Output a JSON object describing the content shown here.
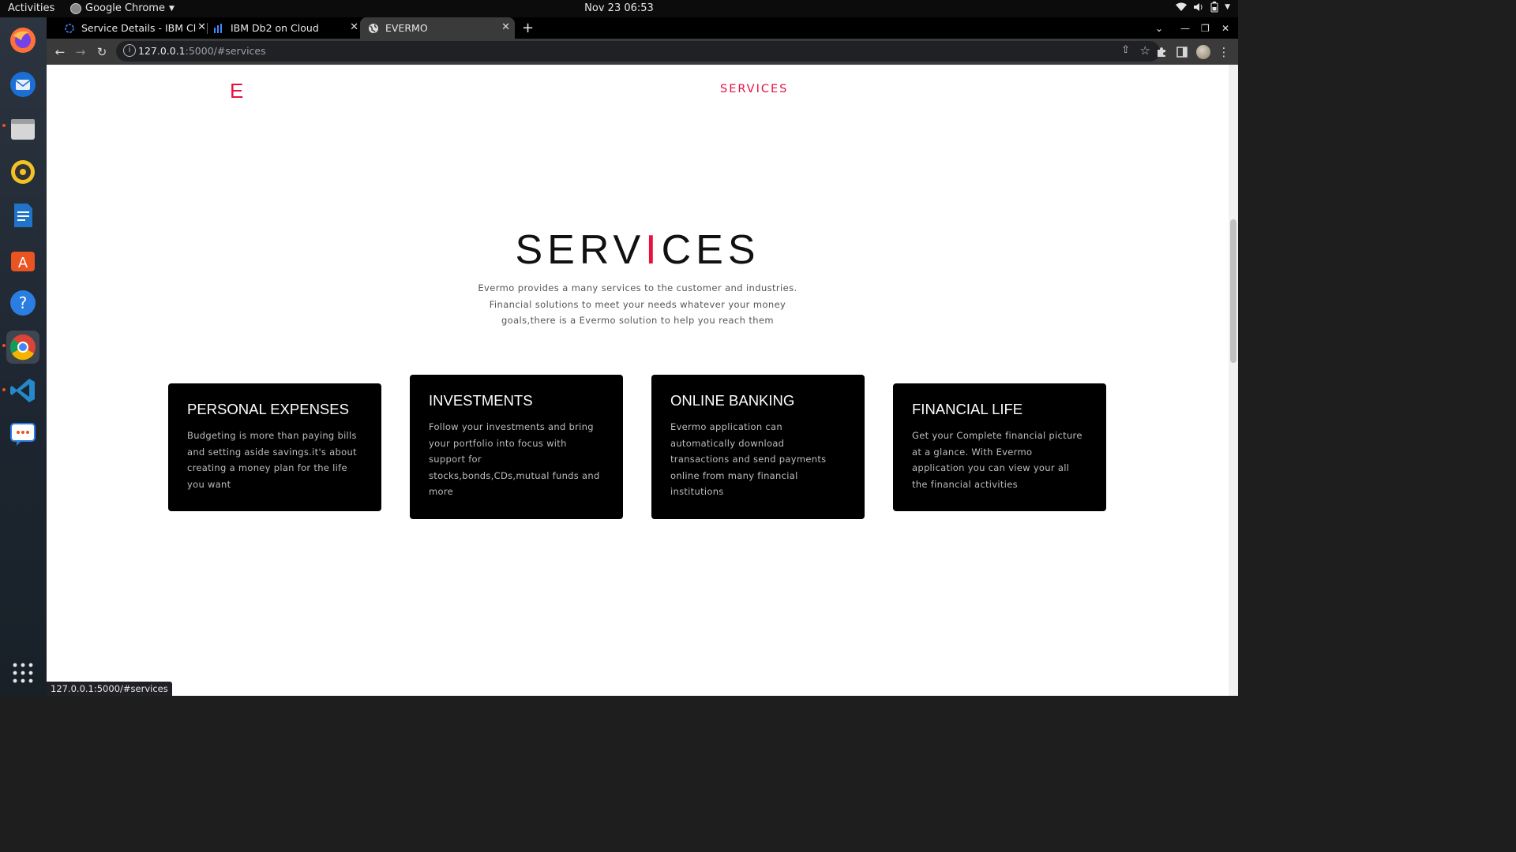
{
  "system": {
    "activities": "Activities",
    "app_name": "Google Chrome",
    "clock": "Nov 23  06:53"
  },
  "dock": [
    "firefox-icon",
    "thunderbird-icon",
    "files-icon",
    "rhythmbox-icon",
    "writer-icon",
    "software-center-icon",
    "help-icon",
    "chrome-icon",
    "vscode-icon",
    "chat-icon",
    "app-grid-icon"
  ],
  "tabs": [
    {
      "title": "Service Details - IBM Cloud",
      "active": false
    },
    {
      "title": "IBM Db2 on Cloud",
      "active": false
    },
    {
      "title": "EVERMO",
      "active": true
    }
  ],
  "address": {
    "host": "127.0.0.1",
    "path": ":5000/#services"
  },
  "site": {
    "logo": "E",
    "nav": "SERVICES",
    "title_left": "SERV",
    "title_bar": "I",
    "title_right": "CES",
    "intro": "Evermo provides a many services to the customer and industries. Financial solutions to meet your needs whatever your money goals,there is a Evermo solution to help you reach them"
  },
  "cards": [
    {
      "title": "PERSONAL EXPENSES",
      "text": "Budgeting is more than paying bills and setting aside savings.it's about creating a money plan for the life you want"
    },
    {
      "title": "INVESTMENTS",
      "text": "Follow your investments and bring your portfolio into focus with support for stocks,bonds,CDs,mutual funds and more"
    },
    {
      "title": "ONLINE BANKING",
      "text": "Evermo application can automatically download transactions and send payments online from many financial institutions"
    },
    {
      "title": "FINANCIAL LIFE",
      "text": "Get your Complete financial picture at a glance. With Evermo application you can view your all the financial activities"
    }
  ],
  "status_url": "127.0.0.1:5000/#services",
  "colors": {
    "accent": "#e8113d",
    "card_bg": "#000000"
  }
}
